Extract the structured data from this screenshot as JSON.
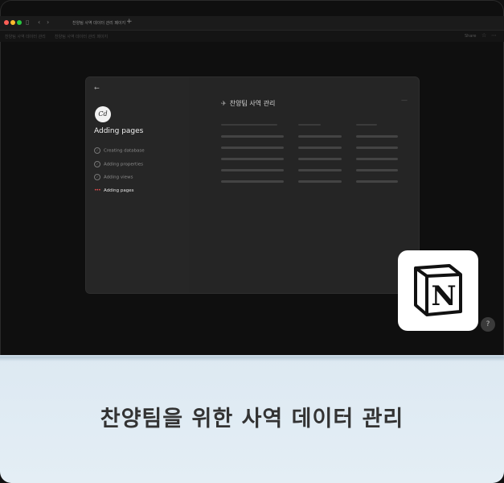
{
  "window": {
    "tab_title": "찬양팀 사역 데이터 관리 페이지",
    "add_tab": "+",
    "breadcrumb_1": "찬양팀 사역 데이터 관리",
    "breadcrumb_2": "찬양팀 사역 데이터 관리 페이지",
    "share_label": "Share"
  },
  "modal": {
    "back": "←",
    "logo_text": "Cd",
    "sidebar_title": "Adding pages",
    "steps": [
      {
        "label": "Creating database",
        "done": true
      },
      {
        "label": "Adding properties",
        "done": true
      },
      {
        "label": "Adding views",
        "done": true
      },
      {
        "label": "Adding pages",
        "done": false,
        "active": true
      }
    ],
    "database_title": "찬양팀 사역 관리"
  },
  "badge": {
    "icon": "notion-logo-icon"
  },
  "caption": "찬양팀을 위한 사역 데이터 관리",
  "colors": {
    "background": "#0f0f0f",
    "modal": "#252525",
    "caption_band": "#e0ecf4",
    "caption_text": "#333333"
  }
}
